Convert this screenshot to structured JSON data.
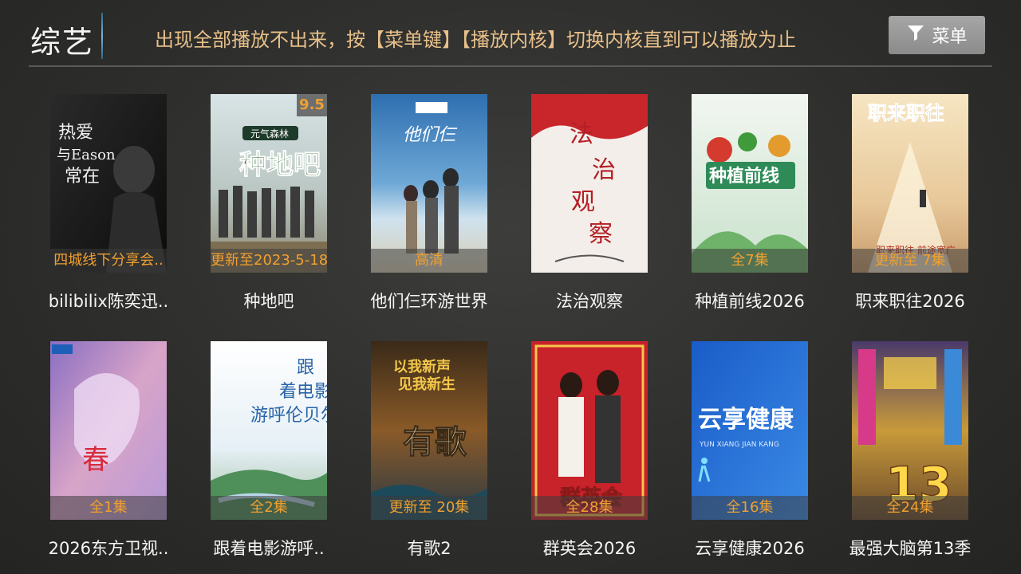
{
  "header": {
    "title": "综艺",
    "notice": "出现全部播放不出来，按【菜单键】【播放内核】切换内核直到可以播放为止",
    "menu_label": "菜单",
    "menu_icon": "filter-icon"
  },
  "items": [
    {
      "name": "bilibilix陈奕迅..",
      "badge": "四城线下分享会..",
      "poster_text": "热爱与Eason常在"
    },
    {
      "name": "种地吧",
      "badge": "更新至2023-5-18.",
      "rating": "9.5",
      "poster_text": "种地吧"
    },
    {
      "name": "他们仨环游世界",
      "badge": "高清",
      "poster_text": "他们仨"
    },
    {
      "name": "法治观察",
      "badge": "",
      "poster_text": "法治观察"
    },
    {
      "name": "种植前线2026",
      "badge": "全7集",
      "poster_text": "种植前线"
    },
    {
      "name": "职来职往2026",
      "badge": "更新至 7集",
      "poster_text": "职来职往"
    },
    {
      "name": "2026东方卫视..",
      "badge": "全1集",
      "poster_text": "春"
    },
    {
      "name": "跟着电影游呼..",
      "badge": "全2集",
      "poster_text": "跟着电影游呼伦贝尔"
    },
    {
      "name": "有歌2",
      "badge": "更新至 20集",
      "poster_text": "有歌"
    },
    {
      "name": "群英会2026",
      "badge": "全28集",
      "poster_text": "群英会"
    },
    {
      "name": "云享健康2026",
      "badge": "全16集",
      "poster_text": "云享健康"
    },
    {
      "name": "最强大脑第13季",
      "badge": "全24集",
      "poster_text": "13"
    }
  ],
  "colors": {
    "accent": "#f0a030",
    "notice": "#e8c08a",
    "background": "#33332f"
  }
}
